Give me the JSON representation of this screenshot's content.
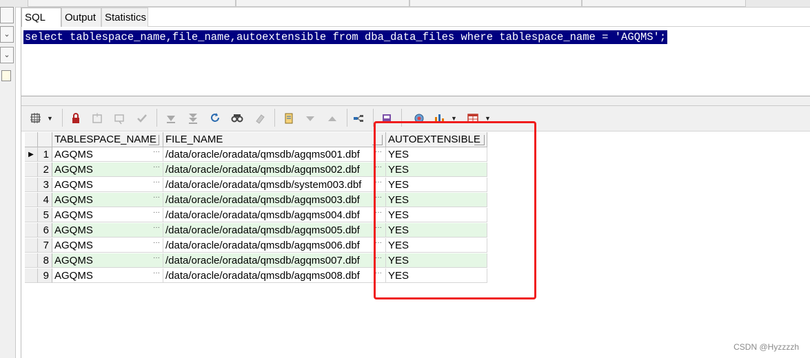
{
  "editor_tabs": [
    {
      "label": "SQL"
    },
    {
      "label": "Output"
    },
    {
      "label": "Statistics"
    }
  ],
  "sql": "select tablespace_name,file_name,autoextensible from dba_data_files where tablespace_name = 'AGQMS';",
  "toolbar_icons": [
    "grid-options-icon",
    "lock-icon",
    "insert-record-icon",
    "delete-record-icon",
    "post-icon",
    "fetch-next-icon",
    "fetch-last-icon",
    "refresh-icon",
    "find-icon",
    "clear-icon",
    "single-record-icon",
    "previous-record-icon",
    "next-record-icon",
    "query-by-example-icon",
    "export-icon",
    "connection-icon",
    "chart-icon",
    "table-view-icon"
  ],
  "grid": {
    "columns": [
      "TABLESPACE_NAME",
      "FILE_NAME",
      "AUTOEXTENSIBLE"
    ],
    "rows": [
      {
        "num": "1",
        "tablespace": "AGQMS",
        "file": "/data/oracle/oradata/qmsdb/agqms001.dbf",
        "auto": "YES"
      },
      {
        "num": "2",
        "tablespace": "AGQMS",
        "file": "/data/oracle/oradata/qmsdb/agqms002.dbf",
        "auto": "YES"
      },
      {
        "num": "3",
        "tablespace": "AGQMS",
        "file": "/data/oracle/oradata/qmsdb/system003.dbf",
        "auto": "YES"
      },
      {
        "num": "4",
        "tablespace": "AGQMS",
        "file": "/data/oracle/oradata/qmsdb/agqms003.dbf",
        "auto": "YES"
      },
      {
        "num": "5",
        "tablespace": "AGQMS",
        "file": "/data/oracle/oradata/qmsdb/agqms004.dbf",
        "auto": "YES"
      },
      {
        "num": "6",
        "tablespace": "AGQMS",
        "file": "/data/oracle/oradata/qmsdb/agqms005.dbf",
        "auto": "YES"
      },
      {
        "num": "7",
        "tablespace": "AGQMS",
        "file": "/data/oracle/oradata/qmsdb/agqms006.dbf",
        "auto": "YES"
      },
      {
        "num": "8",
        "tablespace": "AGQMS",
        "file": "/data/oracle/oradata/qmsdb/agqms007.dbf",
        "auto": "YES"
      },
      {
        "num": "9",
        "tablespace": "AGQMS",
        "file": "/data/oracle/oradata/qmsdb/agqms008.dbf",
        "auto": "YES"
      }
    ]
  },
  "colors": {
    "selection": "#000080",
    "alt_row": "#e5f7e5",
    "highlight_box": "#f01c1c"
  },
  "watermark": "CSDN @Hyzzzzh"
}
